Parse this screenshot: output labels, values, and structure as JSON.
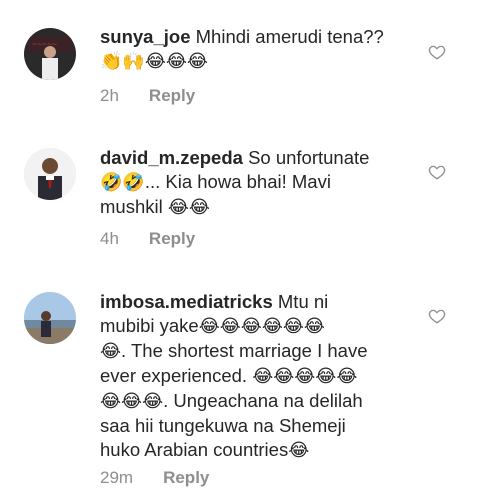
{
  "comments": [
    {
      "username": "sunya_joe",
      "text": "Mhindi amerudi tena??",
      "emoji_line": "👏🙌😂😂😂",
      "time": "2h",
      "reply_label": "Reply",
      "like_icon": "heart-outline-icon"
    },
    {
      "username": "david_m.zepeda",
      "text_a": "So unfortunate",
      "emoji_a": "🤣🤣",
      "text_b": "... Kia howa bhai! Mavi",
      "text_c": "mushkil",
      "emoji_c": "😂😂",
      "time": "4h",
      "reply_label": "Reply",
      "like_icon": "heart-outline-icon"
    },
    {
      "username": "imbosa.mediatricks",
      "text_1": "Mtu ni",
      "text_2": "mubibi yake",
      "emoji_2": "😂😂😂😂😂😂",
      "emoji_3": "😂",
      "text_3": ". The shortest marriage I have",
      "text_4": "ever experienced.",
      "emoji_4": "😂😂😂😂😂",
      "emoji_5": "😂😂😂",
      "text_5": ". Ungeachana na delilah",
      "text_6": "saa hii tungekuwa na Shemeji",
      "text_7": "huko Arabian countries",
      "emoji_7": "😂",
      "time": "29m",
      "reply_label": "Reply",
      "like_icon": "heart-outline-icon"
    }
  ],
  "colors": {
    "text": "#262626",
    "secondary": "#8e8e8e",
    "background": "#ffffff"
  }
}
